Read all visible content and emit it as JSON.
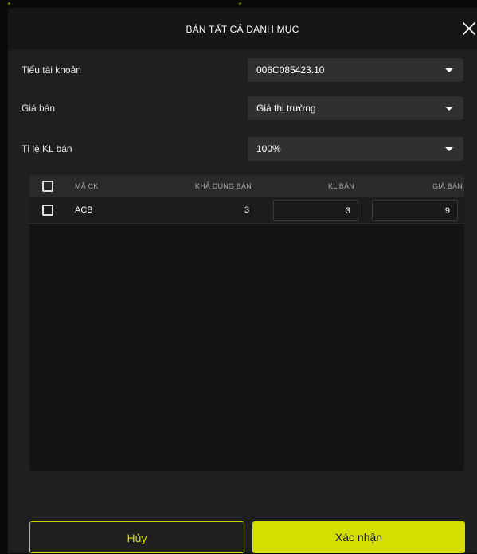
{
  "modal": {
    "title": "BÁN TẤT CẢ DANH MỤC",
    "close_icon": "close-icon"
  },
  "form": {
    "sub_account": {
      "label": "Tiểu tài khoản",
      "value": "006C085423.10"
    },
    "sell_price": {
      "label": "Giá bán",
      "value": "Giá thị trường"
    },
    "volume_ratio": {
      "label": "Tỉ lệ KL bán",
      "value": "100%"
    }
  },
  "table": {
    "columns": [
      "MÃ CK",
      "KHẢ DỤNG BÁN",
      "KL BÁN",
      "GIÁ BÁN"
    ],
    "rows": [
      {
        "symbol": "ACB",
        "available": "3",
        "sell_volume": "3",
        "sell_price": "9"
      }
    ]
  },
  "actions": {
    "cancel_label": "Hủy",
    "confirm_label": "Xác nhận"
  },
  "colors": {
    "accent": "#d4df00",
    "modal_bg": "#1f1f1f",
    "header_bg": "#161616",
    "input_bg": "#303030"
  }
}
